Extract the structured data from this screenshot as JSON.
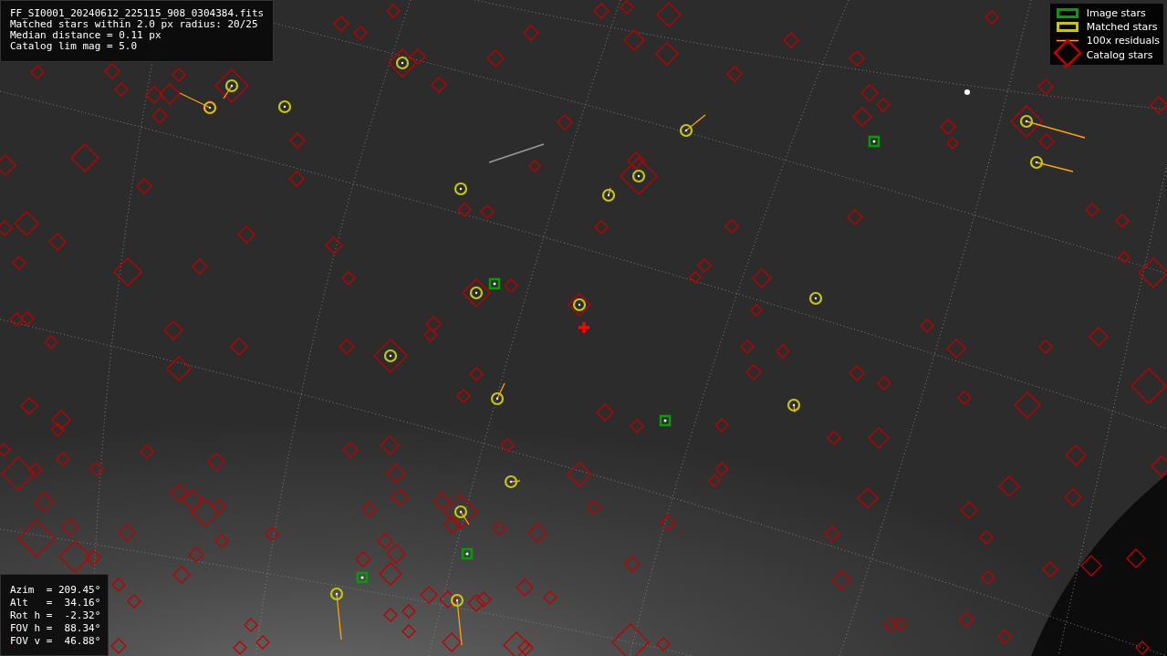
{
  "file_info": {
    "lines": [
      "FF_SI0001_20240612_225115_908_0304384.fits",
      "Matched stars within 2.0 px radius: 20/25",
      "Median distance = 0.11 px",
      "Catalog lim mag = 5.0"
    ]
  },
  "legend": {
    "items": [
      {
        "label": "Image stars",
        "kind": "box",
        "color": "#00a000"
      },
      {
        "label": "Matched stars",
        "kind": "box",
        "color": "#c8c800"
      },
      {
        "label": "100x residuals",
        "kind": "line",
        "color": "#ffa500"
      },
      {
        "label": "Catalog stars",
        "kind": "diamond",
        "color": "#c00000"
      }
    ]
  },
  "pointing": {
    "lines": [
      "Azim  = 209.45°",
      "Alt   =  34.16°",
      "Rot h =  -2.32°",
      "FOV h =  88.34°",
      "FOV v =  46.88°"
    ]
  }
}
